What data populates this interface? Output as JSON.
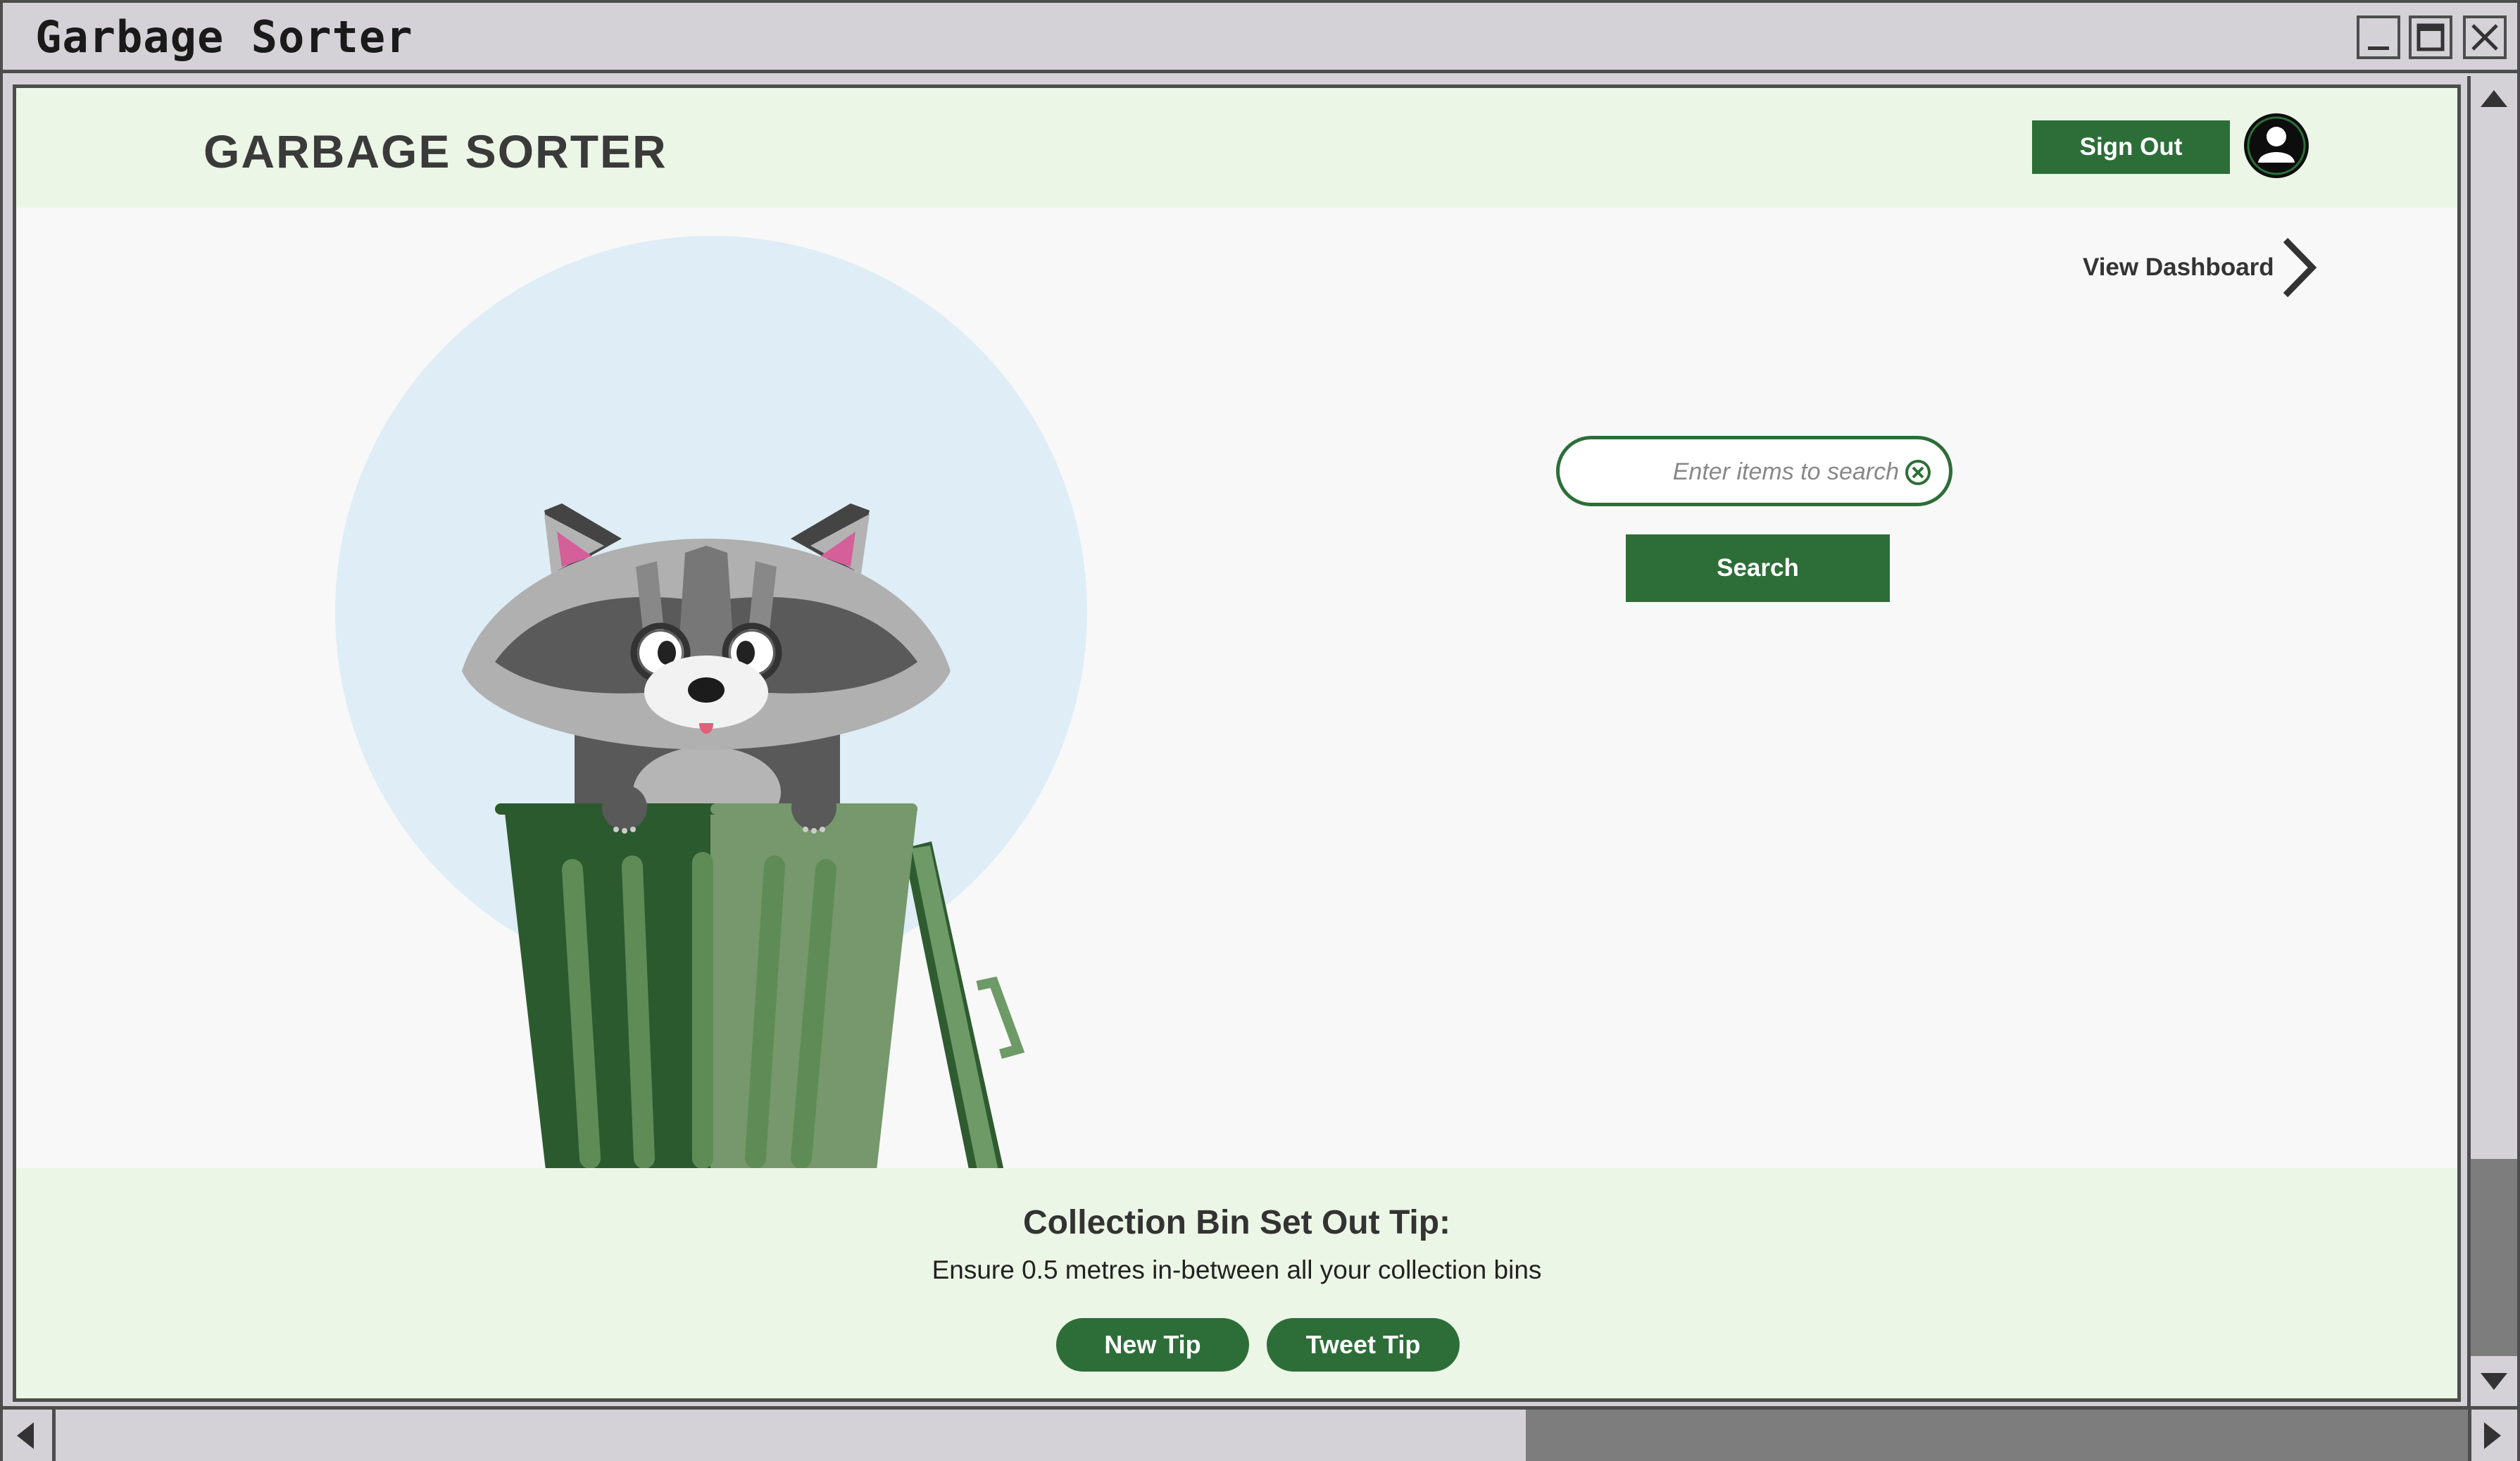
{
  "window": {
    "title": "Garbage Sorter"
  },
  "header": {
    "logo": "GARBAGE SORTER",
    "sign_out_label": "Sign Out"
  },
  "nav": {
    "view_dashboard_label": "View Dashboard"
  },
  "search": {
    "placeholder": "Enter items to search",
    "value": "",
    "button_label": "Search"
  },
  "tip": {
    "title": "Collection Bin Set Out Tip:",
    "body": "Ensure 0.5 metres in-between all your collection bins",
    "new_tip_label": "New Tip",
    "tweet_tip_label": "Tweet Tip"
  },
  "icons": {
    "minimize": "minimize-icon",
    "maximize": "maximize-icon",
    "close": "close-icon",
    "avatar": "user-avatar-icon",
    "chevron": "chevron-right-icon",
    "clear": "clear-circle-x-icon"
  },
  "colors": {
    "primary_green": "#2d6e38",
    "header_bg": "#ecf6e6",
    "page_bg": "#f8f8f8",
    "chrome": "#d4d2d7",
    "illustration_circle": "#deedf6"
  }
}
